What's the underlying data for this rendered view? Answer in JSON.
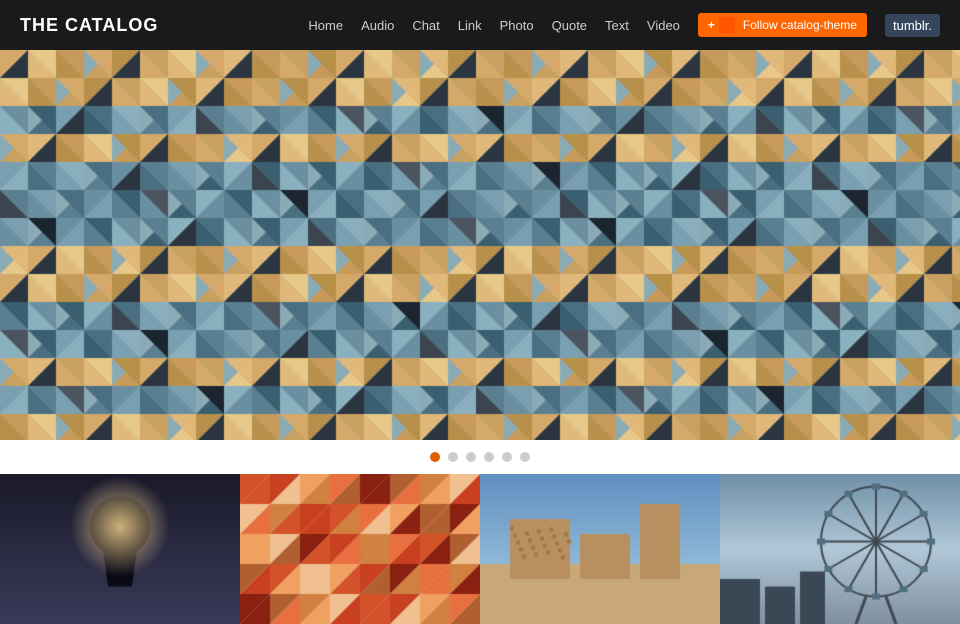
{
  "header": {
    "title": "THE CATALOG",
    "nav": {
      "items": [
        {
          "label": "Home",
          "href": "#"
        },
        {
          "label": "Audio",
          "href": "#"
        },
        {
          "label": "Chat",
          "href": "#"
        },
        {
          "label": "Link",
          "href": "#"
        },
        {
          "label": "Photo",
          "href": "#"
        },
        {
          "label": "Quote",
          "href": "#"
        },
        {
          "label": "Text",
          "href": "#"
        },
        {
          "label": "Video",
          "href": "#"
        }
      ],
      "follow_label": "Follow catalog-theme",
      "tumblr_label": "tumblr."
    }
  },
  "slideshow": {
    "dots": [
      {
        "active": true
      },
      {
        "active": false
      },
      {
        "active": false
      },
      {
        "active": false
      },
      {
        "active": false
      },
      {
        "active": false
      }
    ]
  },
  "thumbnails": [
    {
      "alt": "keyhole image"
    },
    {
      "alt": "geometric triangles"
    },
    {
      "alt": "barcelona architecture"
    },
    {
      "alt": "london eye"
    }
  ]
}
